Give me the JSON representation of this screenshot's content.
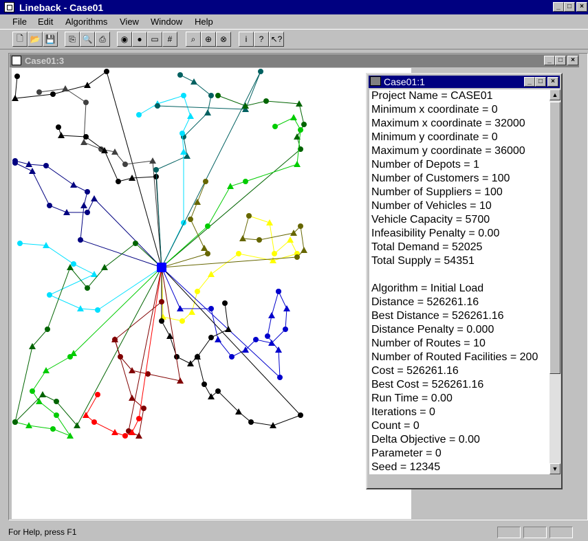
{
  "app": {
    "title": "Lineback - Case01",
    "menu": [
      "File",
      "Edit",
      "Algorithms",
      "View",
      "Window",
      "Help"
    ],
    "window_buttons": [
      "_",
      "□",
      "×"
    ]
  },
  "toolbar": {
    "buttons": [
      {
        "icon": "new-file-icon",
        "glyph": "🗋"
      },
      {
        "icon": "open-folder-icon",
        "glyph": "📂"
      },
      {
        "icon": "save-icon",
        "glyph": "💾"
      },
      {
        "icon": "copy-icon",
        "glyph": "⎘"
      },
      {
        "icon": "print-preview-icon",
        "glyph": "🔍"
      },
      {
        "icon": "print-icon",
        "glyph": "⎙"
      },
      {
        "icon": "route-node-icon",
        "glyph": "◉"
      },
      {
        "icon": "customer-node-icon",
        "glyph": "●"
      },
      {
        "icon": "depot-icon",
        "glyph": "▭"
      },
      {
        "icon": "grid-icon",
        "glyph": "#"
      },
      {
        "icon": "zoom-icon",
        "glyph": "⌕"
      },
      {
        "icon": "zoom-in-icon",
        "glyph": "⊕"
      },
      {
        "icon": "zoom-out-icon",
        "glyph": "⊗"
      },
      {
        "icon": "info-icon",
        "glyph": "i"
      },
      {
        "icon": "help-icon",
        "glyph": "?"
      },
      {
        "icon": "context-help-icon",
        "glyph": "↖?"
      }
    ]
  },
  "child_window": {
    "title": "Case01:3",
    "buttons": [
      "_",
      "□",
      "×"
    ]
  },
  "info_window": {
    "title": "Case01:1",
    "buttons": [
      "_",
      "□",
      "×"
    ],
    "lines": [
      "Project Name = CASE01",
      "Minimum x coordinate = 0",
      "Maximum x coordinate = 32000",
      "Minimum y coordinate = 0",
      "Maximum y coordinate = 36000",
      "Number of Depots = 1",
      "Number of Customers = 100",
      "Number of Suppliers = 100",
      "Number of Vehicles = 10",
      "Vehicle Capacity = 5700",
      "Infeasibility Penalty = 0.00",
      "Total Demand = 52025",
      "Total Supply = 54351",
      "",
      "Algorithm = Initial Load",
      "Distance = 526261.16",
      "Best Distance = 526261.16",
      "Distance Penalty = 0.000",
      "Number of Routes = 10",
      "Number of Routed Facilities = 200",
      "Cost = 526261.16",
      "Best Cost = 526261.16",
      "Run Time = 0.00",
      "Iterations = 0",
      "Count = 0",
      "Delta Objective = 0.00",
      "Parameter = 0",
      "Seed = 12345"
    ]
  },
  "status": {
    "text": "For Help, press F1"
  },
  "routes": {
    "depot_color": "#0000ff",
    "colors": [
      "#000000",
      "#404040",
      "#006060",
      "#00e0ff",
      "#006400",
      "#00cc00",
      "#666600",
      "#ffff00",
      "#0000cc",
      "#800000",
      "#ff0000",
      "#000080"
    ]
  }
}
